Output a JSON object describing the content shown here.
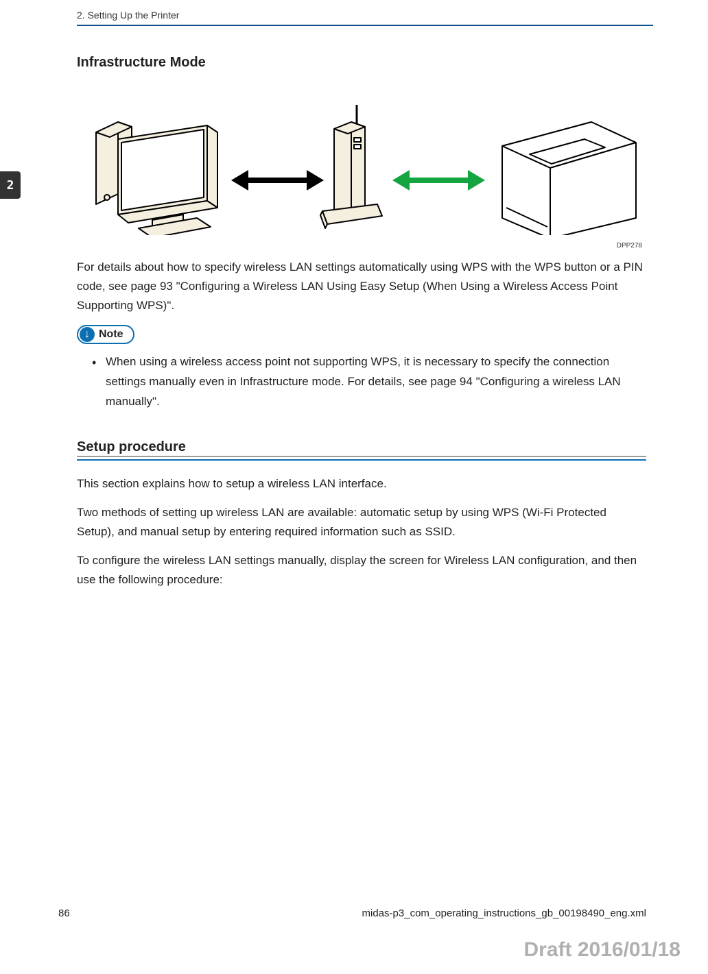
{
  "header": {
    "chapter_label": "2. Setting Up the Printer"
  },
  "tab": {
    "number": "2"
  },
  "section": {
    "title": "Infrastructure Mode",
    "diagram_id": "DPP278",
    "paragraph_1": "For details about how to specify wireless LAN settings automatically using WPS with the WPS button or a PIN code, see page 93 \"Configuring a Wireless LAN Using Easy Setup (When Using a Wireless Access Point Supporting WPS)\"."
  },
  "note": {
    "label": "Note",
    "items": [
      "When using a wireless access point not supporting WPS, it is necessary to specify the connection settings manually even in Infrastructure mode. For details, see page 94 \"Configuring a wireless LAN manually\"."
    ]
  },
  "subsection": {
    "title": "Setup procedure",
    "paragraph_1": "This section explains how to setup a wireless LAN interface.",
    "paragraph_2": "Two methods of setting up wireless LAN are available: automatic setup by using WPS (Wi-Fi Protected Setup), and manual setup by entering required information such as SSID.",
    "paragraph_3": "To configure the wireless LAN settings manually, display the screen for Wireless LAN configuration, and then use the following procedure:"
  },
  "footer": {
    "page_number": "86",
    "file_name": "midas-p3_com_operating_instructions_gb_00198490_eng.xml"
  },
  "draft": {
    "text": "Draft 2016/01/18"
  }
}
